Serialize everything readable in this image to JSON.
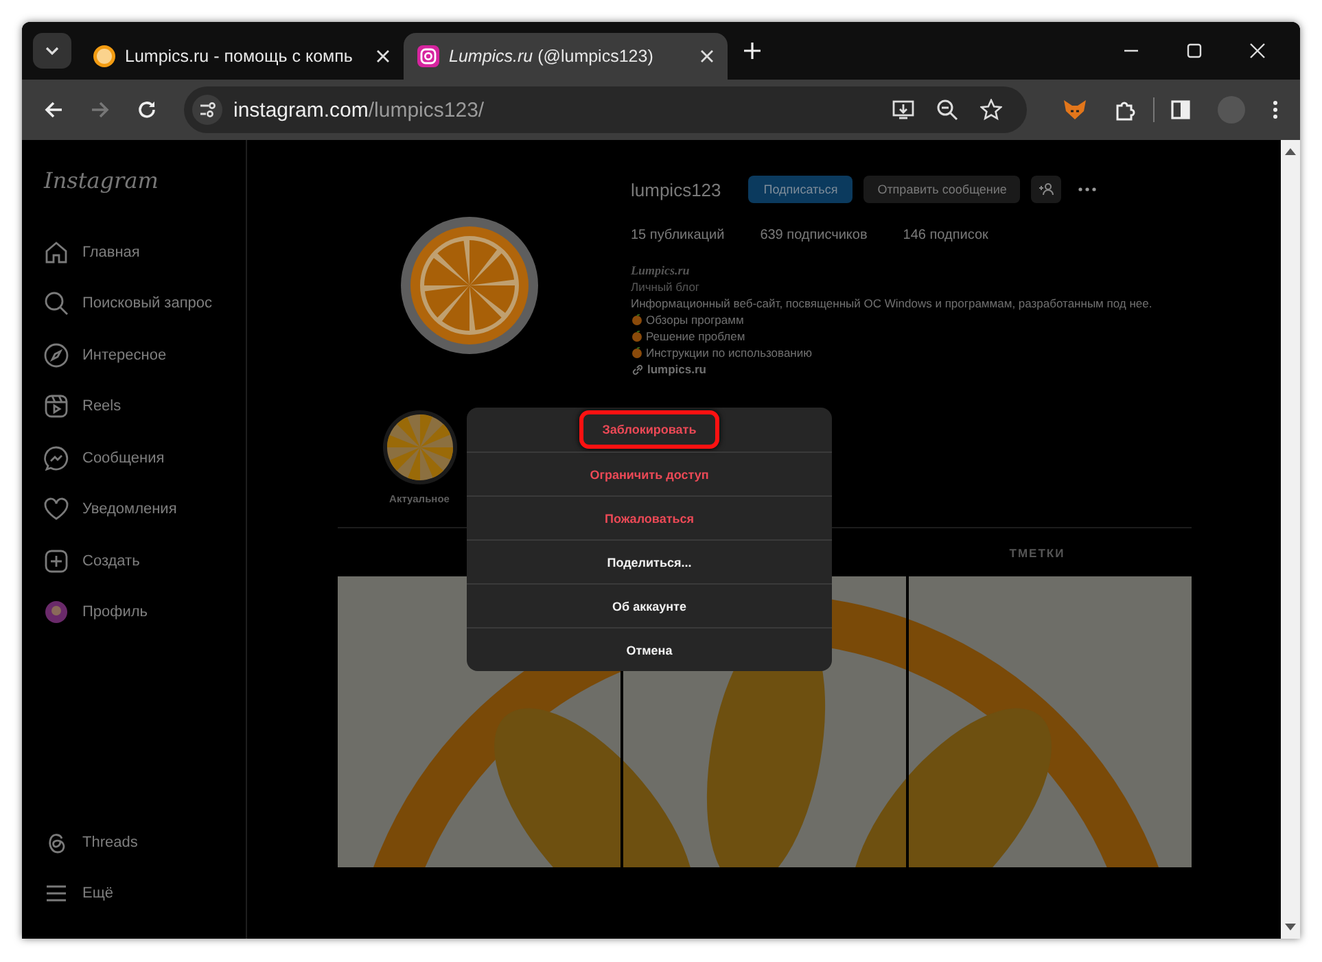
{
  "browser": {
    "tabs": [
      {
        "title": "Lumpics.ru - помощь с компь",
        "selected": false
      },
      {
        "title": "*Lumpics.ru* (@lumpics123)",
        "selected": true
      }
    ],
    "address": {
      "host": "instagram.com",
      "path": "/lumpics123/"
    }
  },
  "sidebar": {
    "logo": "Instagram",
    "items": [
      {
        "kind": "home",
        "label": "Главная"
      },
      {
        "kind": "search",
        "label": "Поисковый запрос"
      },
      {
        "kind": "explore",
        "label": "Интересное"
      },
      {
        "kind": "reels",
        "label": "Reels"
      },
      {
        "kind": "messages",
        "label": "Сообщения"
      },
      {
        "kind": "notifications",
        "label": "Уведомления"
      },
      {
        "kind": "create",
        "label": "Создать"
      },
      {
        "kind": "profile",
        "label": "Профиль"
      }
    ],
    "bottom_items": [
      {
        "kind": "threads",
        "label": "Threads"
      },
      {
        "kind": "more",
        "label": "Ещё"
      }
    ]
  },
  "profile": {
    "username": "lumpics123",
    "follow_button": "Подписаться",
    "message_button": "Отправить сообщение",
    "stats": [
      "15 публикаций",
      "639 подписчиков",
      "146 подписок"
    ],
    "bio": {
      "name": "Lumpics.ru",
      "category": "Личный блог",
      "description": "Информационный веб-сайт, посвященный ОС Windows и программам, разработанным под нее.",
      "bullets": [
        "Обзоры программ",
        "Решение проблем",
        "Инструкции по использованию"
      ],
      "link": "lumpics.ru"
    },
    "highlight": {
      "label": "Актуальное"
    },
    "tab_label": "ТМЕТКИ"
  },
  "menu": {
    "items": [
      {
        "label": "Заблокировать",
        "kind": "danger",
        "highlighted": true
      },
      {
        "label": "Ограничить доступ",
        "kind": "danger",
        "highlighted": false
      },
      {
        "label": "Пожаловаться",
        "kind": "danger",
        "highlighted": false
      },
      {
        "label": "Поделиться...",
        "kind": "normal",
        "highlighted": false
      },
      {
        "label": "Об аккаунте",
        "kind": "normal",
        "highlighted": false
      },
      {
        "label": "Отмена",
        "kind": "normal",
        "highlighted": false
      }
    ]
  }
}
